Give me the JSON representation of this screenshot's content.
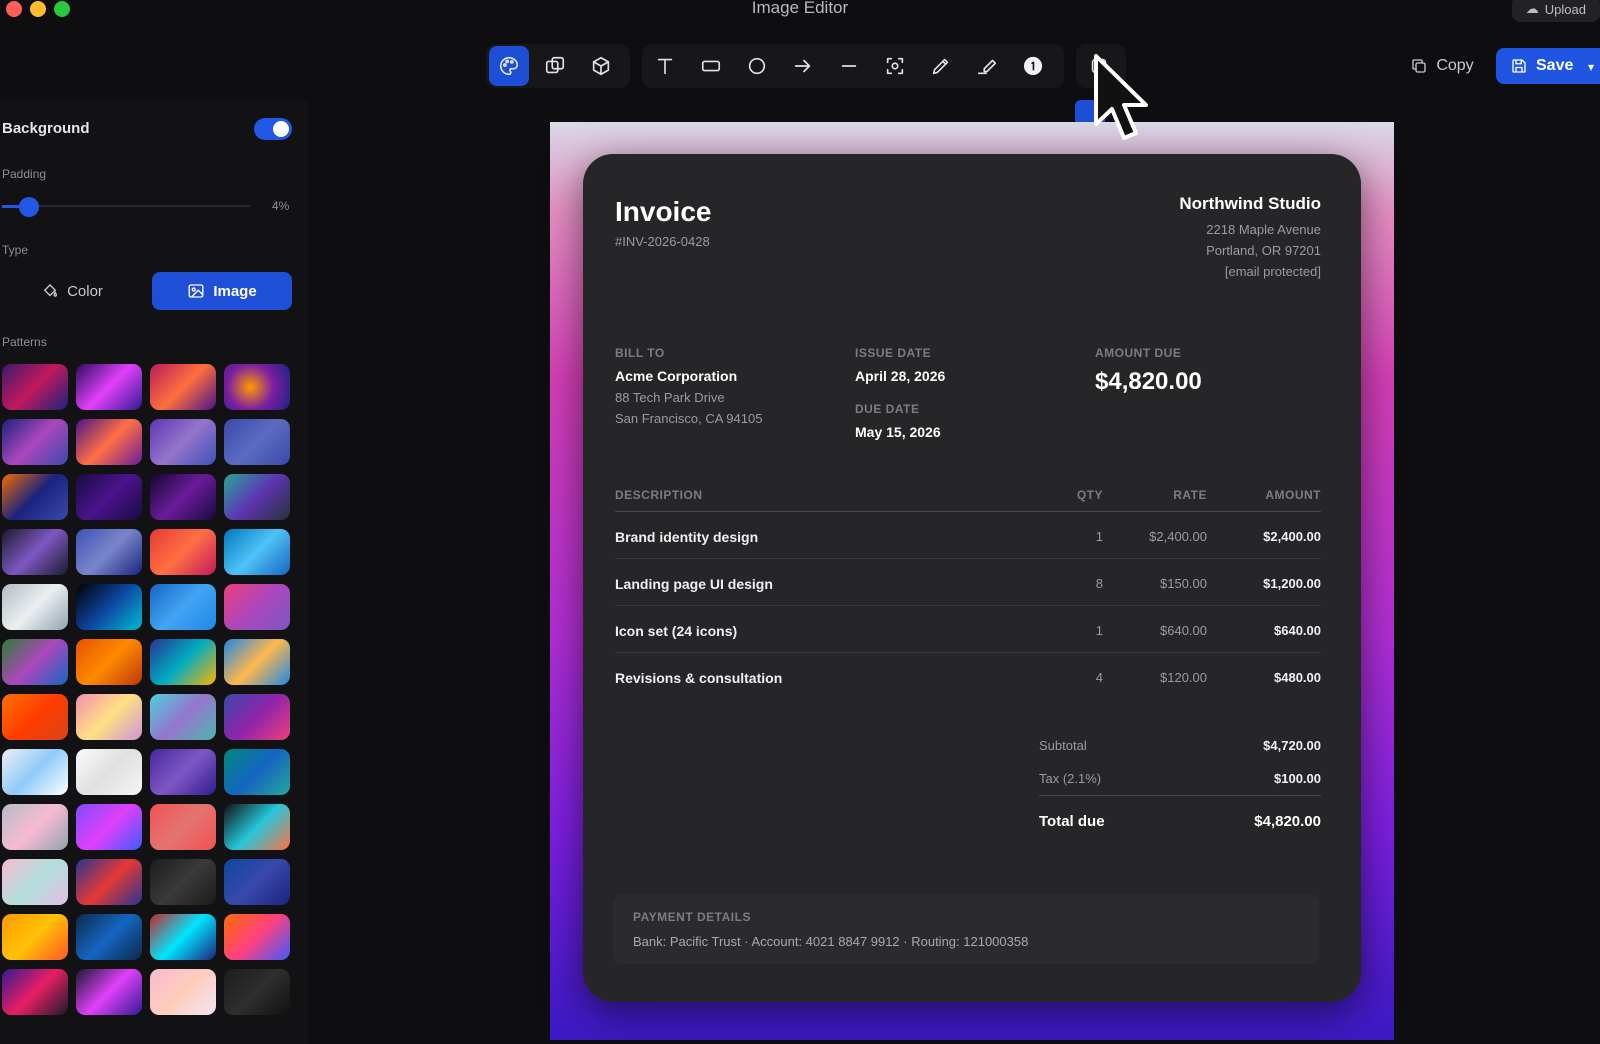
{
  "window": {
    "title": "Image Editor",
    "upload_label": "Upload"
  },
  "toolbar": {
    "tools": [
      "palette-icon",
      "crop-icon",
      "cube-icon",
      "text-icon",
      "rectangle-icon",
      "circle-icon",
      "arrow-icon",
      "line-icon",
      "focus-icon",
      "pen-icon",
      "highlighter-icon",
      "number-icon",
      "blur-icon"
    ],
    "copy_label": "Copy",
    "save_label": "Save",
    "accent": "#1f55e0"
  },
  "sidebar": {
    "background_label": "Background",
    "background_enabled": true,
    "padding_label": "Padding",
    "padding_value": "4%",
    "padding_fraction": 0.04,
    "type_label": "Type",
    "type_color_label": "Color",
    "type_image_label": "Image",
    "patterns_label": "Patterns"
  },
  "invoice": {
    "title": "Invoice",
    "number": "#INV-2026-0428",
    "company": "Northwind Studio",
    "address1": "2218 Maple Avenue",
    "address2": "Portland, OR 97201",
    "email": "[email protected]",
    "bill_to_label": "BILL TO",
    "client_name": "Acme Corporation",
    "client_addr1": "88 Tech Park Drive",
    "client_addr2": "San Francisco, CA 94105",
    "issue_date_label": "ISSUE DATE",
    "issue_date": "April 28, 2026",
    "due_date_label": "DUE DATE",
    "due_date": "May 15, 2026",
    "amount_due_label": "AMOUNT DUE",
    "amount_due": "$4,820.00",
    "headers": {
      "description": "DESCRIPTION",
      "qty": "QTY",
      "rate": "RATE",
      "amount": "AMOUNT"
    },
    "items": [
      {
        "description": "Brand identity design",
        "qty": "1",
        "rate": "$2,400.00",
        "amount": "$2,400.00"
      },
      {
        "description": "Landing page UI design",
        "qty": "8",
        "rate": "$150.00",
        "amount": "$1,200.00"
      },
      {
        "description": "Icon set (24 icons)",
        "qty": "1",
        "rate": "$640.00",
        "amount": "$640.00"
      },
      {
        "description": "Revisions & consultation",
        "qty": "4",
        "rate": "$120.00",
        "amount": "$480.00"
      }
    ],
    "subtotal_label": "Subtotal",
    "subtotal": "$4,720.00",
    "tax_label": "Tax (2.1%)",
    "tax": "$100.00",
    "total_label": "Total due",
    "total": "$4,820.00",
    "payment_label": "PAYMENT DETAILS",
    "payment_text": "Bank: Pacific Trust · Account: 4021 8847 9912 · Routing: 121000358"
  }
}
